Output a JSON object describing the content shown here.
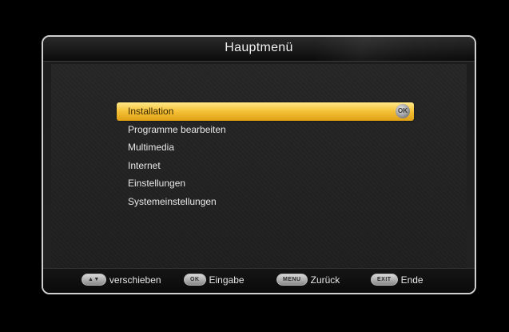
{
  "window": {
    "title": "Hauptmenü"
  },
  "menu": {
    "items": [
      {
        "label": "Installation",
        "selected": true
      },
      {
        "label": "Programme bearbeiten",
        "selected": false
      },
      {
        "label": "Multimedia",
        "selected": false
      },
      {
        "label": "Internet",
        "selected": false
      },
      {
        "label": "Einstellungen",
        "selected": false
      },
      {
        "label": "Systemeinstellungen",
        "selected": false
      }
    ],
    "ok_badge": "OK"
  },
  "footer": {
    "hints": [
      {
        "key": "▲▼",
        "label": "verschieben"
      },
      {
        "key": "OK",
        "label": "Eingabe"
      },
      {
        "key": "MENU",
        "label": "Zurück"
      },
      {
        "key": "EXIT",
        "label": "Ende"
      }
    ]
  },
  "colors": {
    "highlight": "#f6c33a",
    "frame_border": "#cfcfcf",
    "background": "#000000"
  }
}
